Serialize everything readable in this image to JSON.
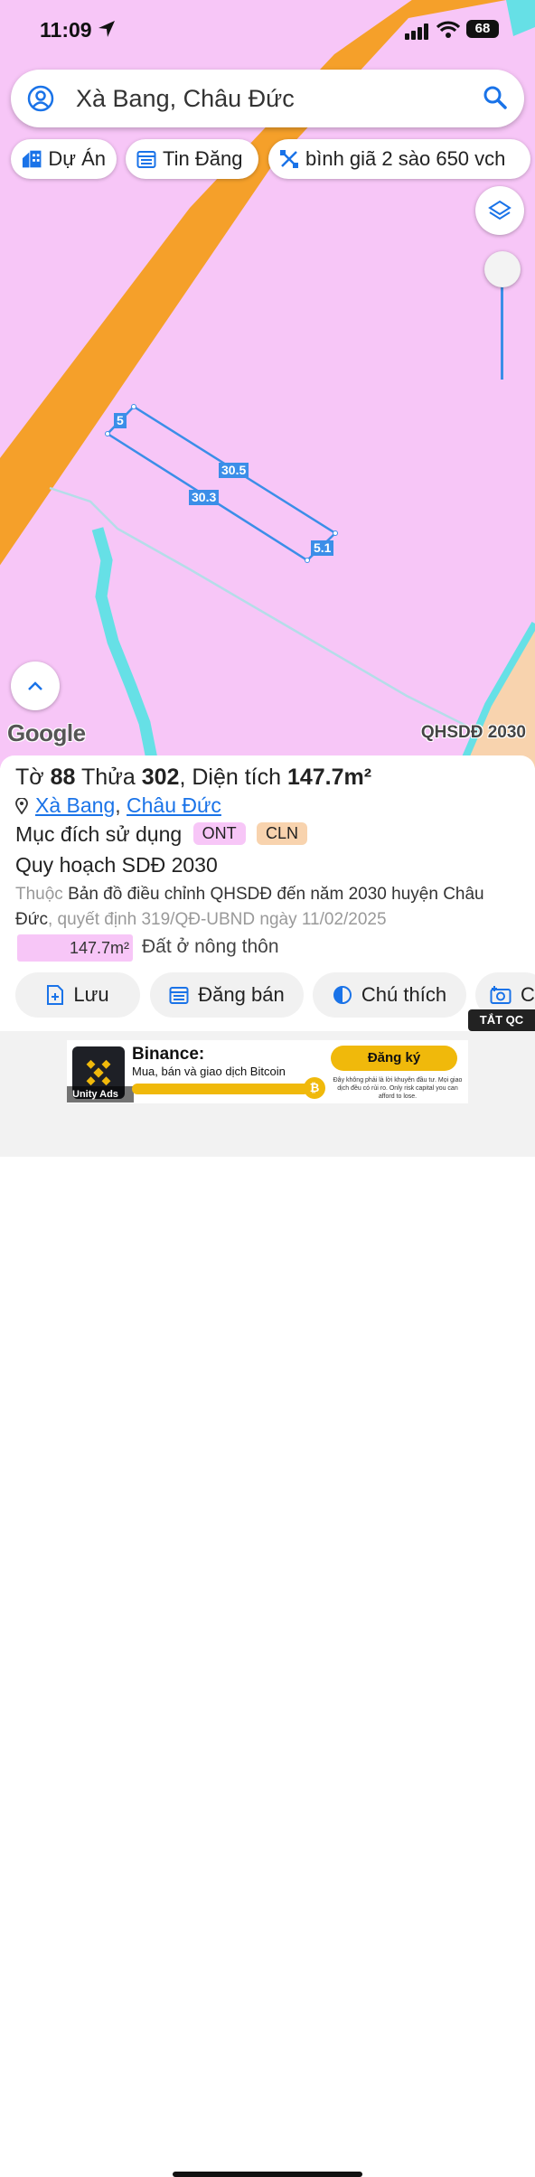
{
  "status_bar": {
    "time": "11:09",
    "battery": "68"
  },
  "search": {
    "query": "Xà Bang, Châu Đức"
  },
  "chips": [
    {
      "label": "Dự Án",
      "icon": "building-icon"
    },
    {
      "label": "Tin Đăng",
      "icon": "calendar-list-icon"
    },
    {
      "label": "bình giã 2 sào 650 vch",
      "icon": "close-tools-icon"
    }
  ],
  "map": {
    "attribution": "Google",
    "layer_label": "QHSDĐ 2030",
    "parcel_dimensions": {
      "top": "30.5",
      "bottom": "30.3",
      "left": "5",
      "right": "5.1"
    },
    "colors": {
      "land_pink": "#f7c6f7",
      "road_orange": "#f5a02a",
      "water_cyan": "#66e0e6",
      "outline_blue": "#3b8ee8"
    }
  },
  "parcel": {
    "to_label": "Tờ",
    "to_value": "88",
    "thua_label": "Thửa",
    "thua_value": "302",
    "dien_tich_label": ", Diện tích",
    "dien_tich_value": "147.7m²",
    "commune": "Xà Bang",
    "district": "Châu Đức",
    "purpose_label": "Mục đích sử dụng",
    "tags": [
      {
        "code": "ONT",
        "color": "#f7c6f7"
      },
      {
        "code": "CLN",
        "color": "#f8d3ae"
      }
    ],
    "plan_title": "Quy hoạch SDĐ 2030",
    "belongs_prefix": "Thuộc",
    "plan_desc": "Bản đồ điều chỉnh QHSDĐ đến năm 2030 huyện Châu Đức",
    "decision": ", quyết định 319/QĐ-UBND ngày 11/02/2025",
    "legend_area": "147.7m²",
    "legend_label": "Đất ở nông thôn"
  },
  "actions": [
    {
      "label": "Lưu",
      "icon": "save-file-icon"
    },
    {
      "label": "Đăng bán",
      "icon": "calendar-list-icon"
    },
    {
      "label": "Chú thích",
      "icon": "half-circle-icon"
    },
    {
      "label": "C",
      "icon": "camera-icon"
    }
  ],
  "ad": {
    "close_label": "TẮT QC",
    "brand": "Binance:",
    "tagline": "Mua, bán và giao dịch Bitcoin",
    "cta": "Đăng ký",
    "disclaimer": "Đây không phải là lời khuyên đầu tư. Mọi giao dịch đều có rủi ro. Only risk capital you can afford to lose.",
    "network": "Unity Ads",
    "coin_symbol": "₿"
  }
}
